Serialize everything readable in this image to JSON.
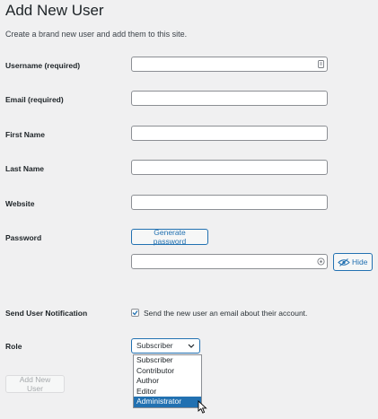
{
  "page": {
    "title": "Add New User",
    "description": "Create a brand new user and add them to this site."
  },
  "form": {
    "username_label": "Username (required)",
    "email_label": "Email (required)",
    "first_name_label": "First Name",
    "last_name_label": "Last Name",
    "website_label": "Website",
    "password_label": "Password",
    "generate_password_label": "Generate password",
    "hide_label": "Hide",
    "notification_label": "Send User Notification",
    "notification_text": "Send the new user an email about their account.",
    "notification_checked": true,
    "role_label": "Role",
    "role_selected": "Subscriber",
    "role_options": [
      "Subscriber",
      "Contributor",
      "Author",
      "Editor",
      "Administrator"
    ],
    "role_highlighted": "Administrator",
    "submit_label": "Add New User"
  },
  "icons": {
    "username_field": "contact-card-icon",
    "password_field": "eye-icon",
    "hide_button": "eye-slash-icon",
    "checkbox": "checkmark-icon",
    "select": "chevron-down-icon",
    "cursor": "mouse-pointer-icon"
  },
  "colors": {
    "accent": "#2271b1",
    "background": "#f0f0f1",
    "disabled_text": "#a7aaad"
  }
}
